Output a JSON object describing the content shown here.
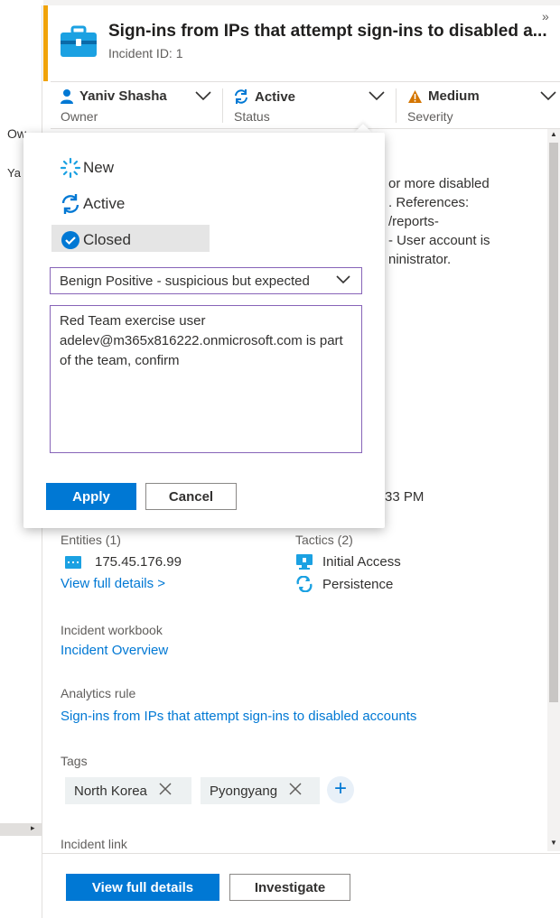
{
  "left_panel": {
    "owner_fragment": "Ow",
    "name_fragment": "Ya"
  },
  "header": {
    "title": "Sign-ins from IPs that attempt sign-ins to disabled a...",
    "incident_id": "Incident ID: 1",
    "collapse_glyph": "»"
  },
  "meta": {
    "owner": {
      "value": "Yaniv Shasha",
      "label": "Owner"
    },
    "status": {
      "value": "Active",
      "label": "Status"
    },
    "severity": {
      "value": "Medium",
      "label": "Severity"
    }
  },
  "status_dropdown": {
    "options": [
      {
        "label": "New",
        "icon": "new-spinner-icon"
      },
      {
        "label": "Active",
        "icon": "refresh-icon"
      },
      {
        "label": "Closed",
        "icon": "checkmark-circle-icon",
        "selected": true
      }
    ],
    "classification": "Benign Positive - suspicious but expected",
    "comment": "Red Team exercise user adelev@m365x816222.onmicrosoft.com is part of the team, confirm",
    "apply_label": "Apply",
    "cancel_label": "Cancel"
  },
  "background_text": {
    "description_lines": [
      "or more disabled",
      ". References:",
      "/reports-",
      "- User account is",
      "ninistrator."
    ],
    "time_fragment": "33 PM"
  },
  "entities": {
    "label": "Entities (1)",
    "items": [
      {
        "value": "175.45.176.99",
        "icon": "ip-address-icon"
      }
    ],
    "view_details": "View full details >"
  },
  "tactics": {
    "label": "Tactics (2)",
    "items": [
      {
        "value": "Initial Access",
        "icon": "initial-access-icon"
      },
      {
        "value": "Persistence",
        "icon": "persistence-icon"
      }
    ]
  },
  "workbook": {
    "label": "Incident workbook",
    "link": "Incident Overview"
  },
  "analytics_rule": {
    "label": "Analytics rule",
    "link": "Sign-ins from IPs that attempt sign-ins to disabled accounts"
  },
  "tags": {
    "label": "Tags",
    "items": [
      "North Korea",
      "Pyongyang"
    ],
    "add_glyph": "+"
  },
  "incident_link": {
    "label": "Incident link"
  },
  "footer": {
    "view_full_details": "View full details",
    "investigate": "Investigate"
  },
  "colors": {
    "accent_orange": "#f0a30a",
    "primary_blue": "#0078d4",
    "focus_purple": "#8764b8",
    "severity_medium": "#d47500"
  }
}
